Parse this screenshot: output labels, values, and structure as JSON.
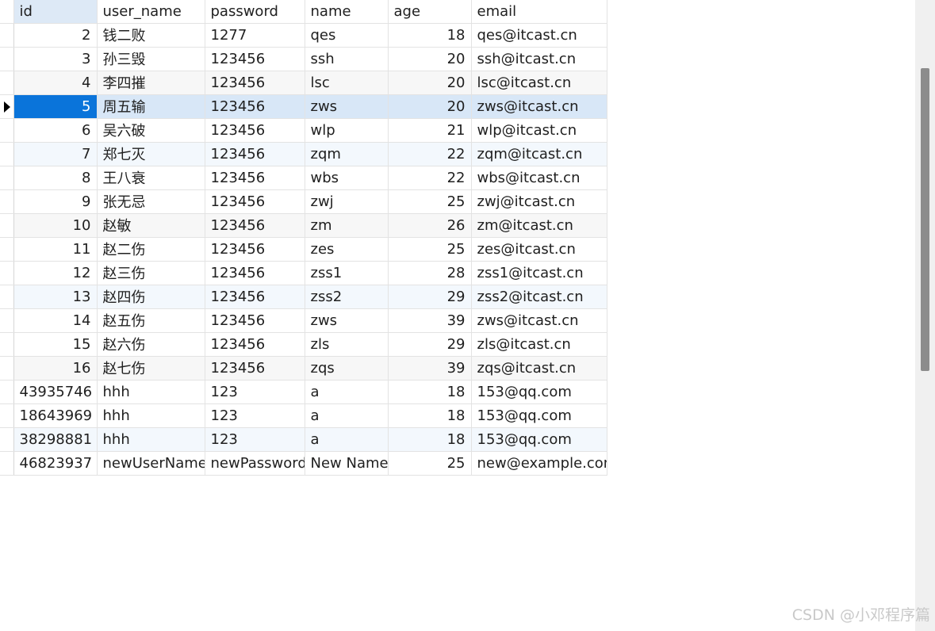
{
  "columns": [
    "id",
    "user_name",
    "password",
    "name",
    "age",
    "email"
  ],
  "rows": [
    {
      "id": "2",
      "user_name": "钱二败",
      "password": "1277",
      "name": "qes",
      "age": "18",
      "email": "qes@itcast.cn"
    },
    {
      "id": "3",
      "user_name": "孙三毁",
      "password": "123456",
      "name": "ssh",
      "age": "20",
      "email": "ssh@itcast.cn"
    },
    {
      "id": "4",
      "user_name": "李四摧",
      "password": "123456",
      "name": "lsc",
      "age": "20",
      "email": "lsc@itcast.cn"
    },
    {
      "id": "5",
      "user_name": "周五输",
      "password": "123456",
      "name": "zws",
      "age": "20",
      "email": "zws@itcast.cn"
    },
    {
      "id": "6",
      "user_name": "吴六破",
      "password": "123456",
      "name": "wlp",
      "age": "21",
      "email": "wlp@itcast.cn"
    },
    {
      "id": "7",
      "user_name": "郑七灭",
      "password": "123456",
      "name": "zqm",
      "age": "22",
      "email": "zqm@itcast.cn"
    },
    {
      "id": "8",
      "user_name": "王八衰",
      "password": "123456",
      "name": "wbs",
      "age": "22",
      "email": "wbs@itcast.cn"
    },
    {
      "id": "9",
      "user_name": "张无忌",
      "password": "123456",
      "name": "zwj",
      "age": "25",
      "email": "zwj@itcast.cn"
    },
    {
      "id": "10",
      "user_name": "赵敏",
      "password": "123456",
      "name": "zm",
      "age": "26",
      "email": "zm@itcast.cn"
    },
    {
      "id": "11",
      "user_name": "赵二伤",
      "password": "123456",
      "name": "zes",
      "age": "25",
      "email": "zes@itcast.cn"
    },
    {
      "id": "12",
      "user_name": "赵三伤",
      "password": "123456",
      "name": "zss1",
      "age": "28",
      "email": "zss1@itcast.cn"
    },
    {
      "id": "13",
      "user_name": "赵四伤",
      "password": "123456",
      "name": "zss2",
      "age": "29",
      "email": "zss2@itcast.cn"
    },
    {
      "id": "14",
      "user_name": "赵五伤",
      "password": "123456",
      "name": "zws",
      "age": "39",
      "email": "zws@itcast.cn"
    },
    {
      "id": "15",
      "user_name": "赵六伤",
      "password": "123456",
      "name": "zls",
      "age": "29",
      "email": "zls@itcast.cn"
    },
    {
      "id": "16",
      "user_name": "赵七伤",
      "password": "123456",
      "name": "zqs",
      "age": "39",
      "email": "zqs@itcast.cn"
    },
    {
      "id": "43935746",
      "user_name": "hhh",
      "password": "123",
      "name": "a",
      "age": "18",
      "email": "153@qq.com"
    },
    {
      "id": "18643969",
      "user_name": "hhh",
      "password": "123",
      "name": "a",
      "age": "18",
      "email": "153@qq.com"
    },
    {
      "id": "38298881",
      "user_name": "hhh",
      "password": "123",
      "name": "a",
      "age": "18",
      "email": "153@qq.com"
    },
    {
      "id": "46823937",
      "user_name": "newUserName",
      "password": "newPassword",
      "name": "New Name",
      "age": "25",
      "email": "new@example.com"
    }
  ],
  "selected_row_id": "5",
  "sorted_column": "id",
  "watermark": "CSDN @小邓程序篇",
  "colors": {
    "selected_row": "#d8e7f7",
    "selected_cell": "#0a74da",
    "header_sorted": "#dde9f6",
    "grid_line": "#e3e3e3",
    "scroll_thumb": "#8c8c8c"
  }
}
